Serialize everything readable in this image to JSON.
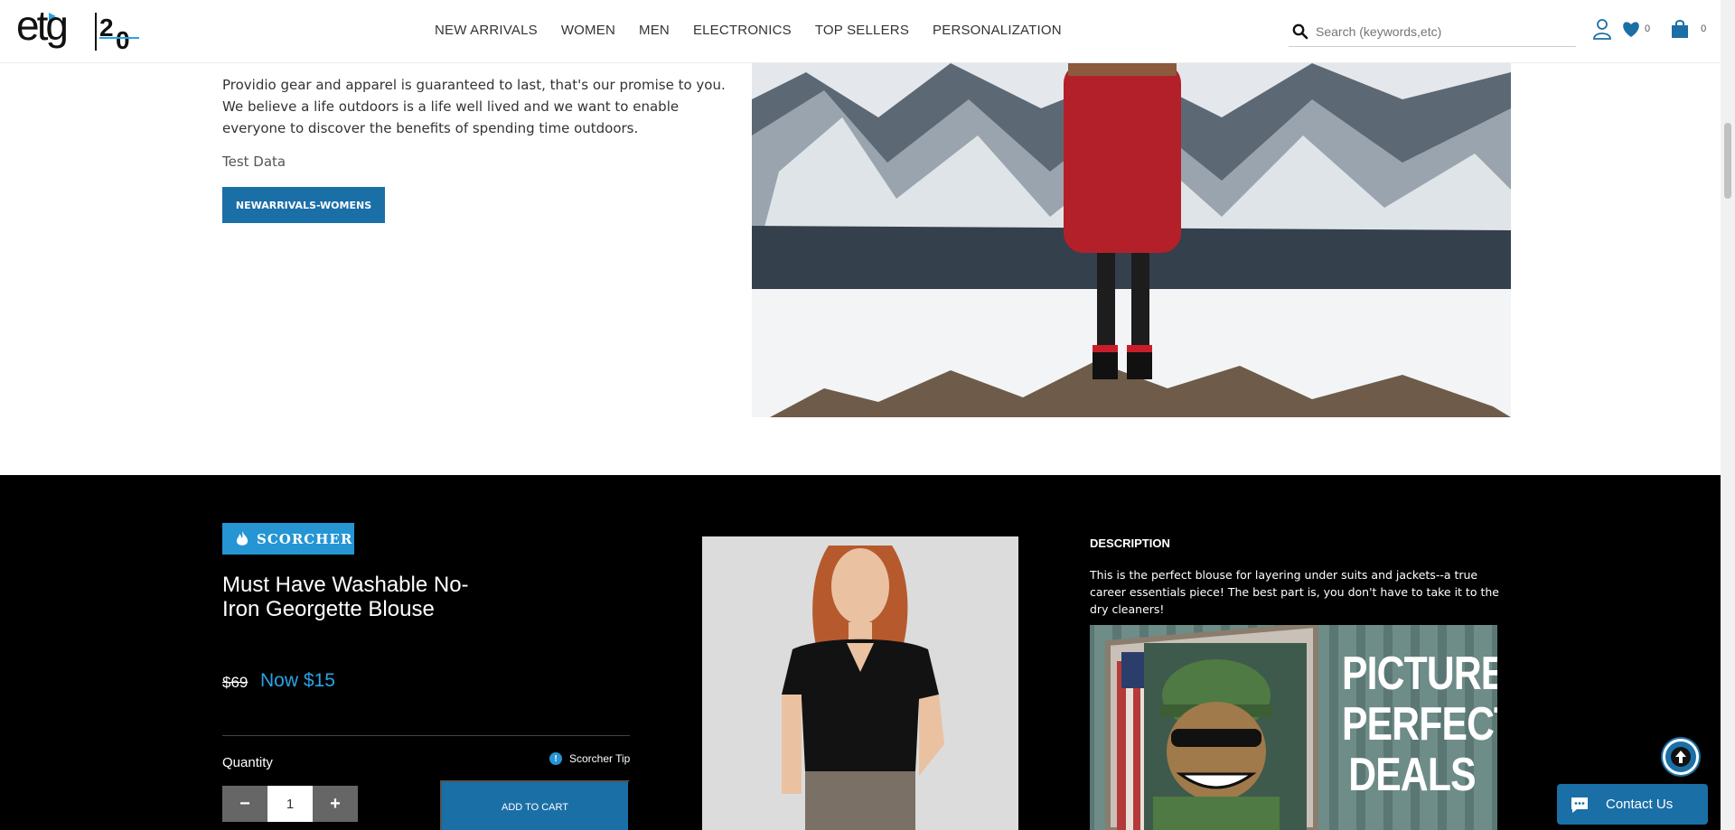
{
  "header": {
    "logo_text": "etg20",
    "nav": [
      "NEW ARRIVALS",
      "WOMEN",
      "MEN",
      "ELECTRONICS",
      "TOP SELLERS",
      "PERSONALIZATION"
    ],
    "search_placeholder": "Search (keywords,etc)",
    "wishlist_count": "0",
    "cart_count": "0"
  },
  "hero": {
    "paragraph": "Providio gear and apparel is guaranteed to last, that's our promise to you. We believe a life outdoors is a life well lived and we want to enable everyone to discover the benefits of spending time outdoors.",
    "test_text": "Test Data",
    "button_label": "NEWARRIVALS-WOMENS"
  },
  "scorcher": {
    "badge": "SCORCHER",
    "title": "Must Have Washable No-Iron Georgette Blouse",
    "price_old": "$69",
    "price_now": "Now $15",
    "quantity_label": "Quantity",
    "tip_label": "Scorcher Tip",
    "tip_glyph": "!",
    "qty_minus": "−",
    "qty_value": "1",
    "qty_plus": "+",
    "add_to_cart": "ADD TO CART",
    "description_heading": "DESCRIPTION",
    "description": "This is the perfect blouse for layering under suits and jackets--a true career essentials piece! The best part is, you don't have to take it to the dry cleaners!",
    "promo_lines": [
      "PICTURE",
      "PERFECT",
      "DEALS"
    ]
  },
  "floating": {
    "contact_label": "Contact Us"
  },
  "colors": {
    "accent": "#1b6fa7",
    "badge": "#2595d4",
    "price_now": "#2aa3e6"
  }
}
